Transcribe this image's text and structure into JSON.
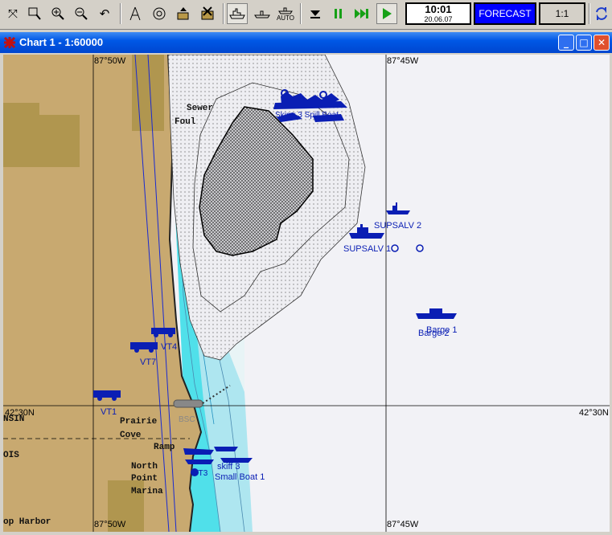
{
  "toolbar": {
    "icons": [
      "fullscreen-icon",
      "zoom-window-icon",
      "zoom-in-icon",
      "zoom-out-icon",
      "undo-icon",
      "drawing-tool-icon",
      "target-icon",
      "upload-icon",
      "cancel-layer-icon",
      "ship-view-icon",
      "ship-side-icon",
      "auto-icon",
      "fast-rewind-icon",
      "pause-icon",
      "fast-forward-icon",
      "play-icon",
      "refresh-icon"
    ],
    "auto_label": "AUTO",
    "clock_time": "10:01",
    "clock_date": "20.06.07",
    "forecast_label": "FORECAST",
    "scale_label": "1:1"
  },
  "window": {
    "title": "Chart 1 - 1:60000",
    "minimize": "_",
    "maximize": "□",
    "close": "✕"
  },
  "map": {
    "lon_top_left": "87°50W",
    "lon_top_right": "87°45W",
    "lon_bottom_left": "87°50W",
    "lon_bottom_right": "87°45W",
    "lat_left": "42°30N",
    "lat_right": "42°30N",
    "place_labels": {
      "sewer": "Sewer",
      "foul": "Foul",
      "prairie": "Prairie",
      "cove": "Cove",
      "ramp": "Ramp",
      "north": "North",
      "point": "Point",
      "marina": "Marina",
      "harbor": "op Harbor",
      "nsin": "NSIN",
      "ois": "OIS"
    },
    "vessel_labels": {
      "supsalv2": "SUPSALV 2",
      "supsalv1": "SUPSALV 1",
      "barge1": "Barge 1",
      "barge2": "Barge 2",
      "vt4": "VT4",
      "vt7": "VT7",
      "vt1": "VT1",
      "skiff3": "skiff 3",
      "smallboat1": "Small Boat 1",
      "vt3": "VT3",
      "bsc": "BSC",
      "spill": "Skimr 3 Spill Boat"
    },
    "colors": {
      "water": "#f2f2f6",
      "land": "#c8a970",
      "land_dark": "#b0964f",
      "shallow": "#50e0ea",
      "mid": "#aee6f0",
      "vessel": "#0a1eb4"
    }
  }
}
